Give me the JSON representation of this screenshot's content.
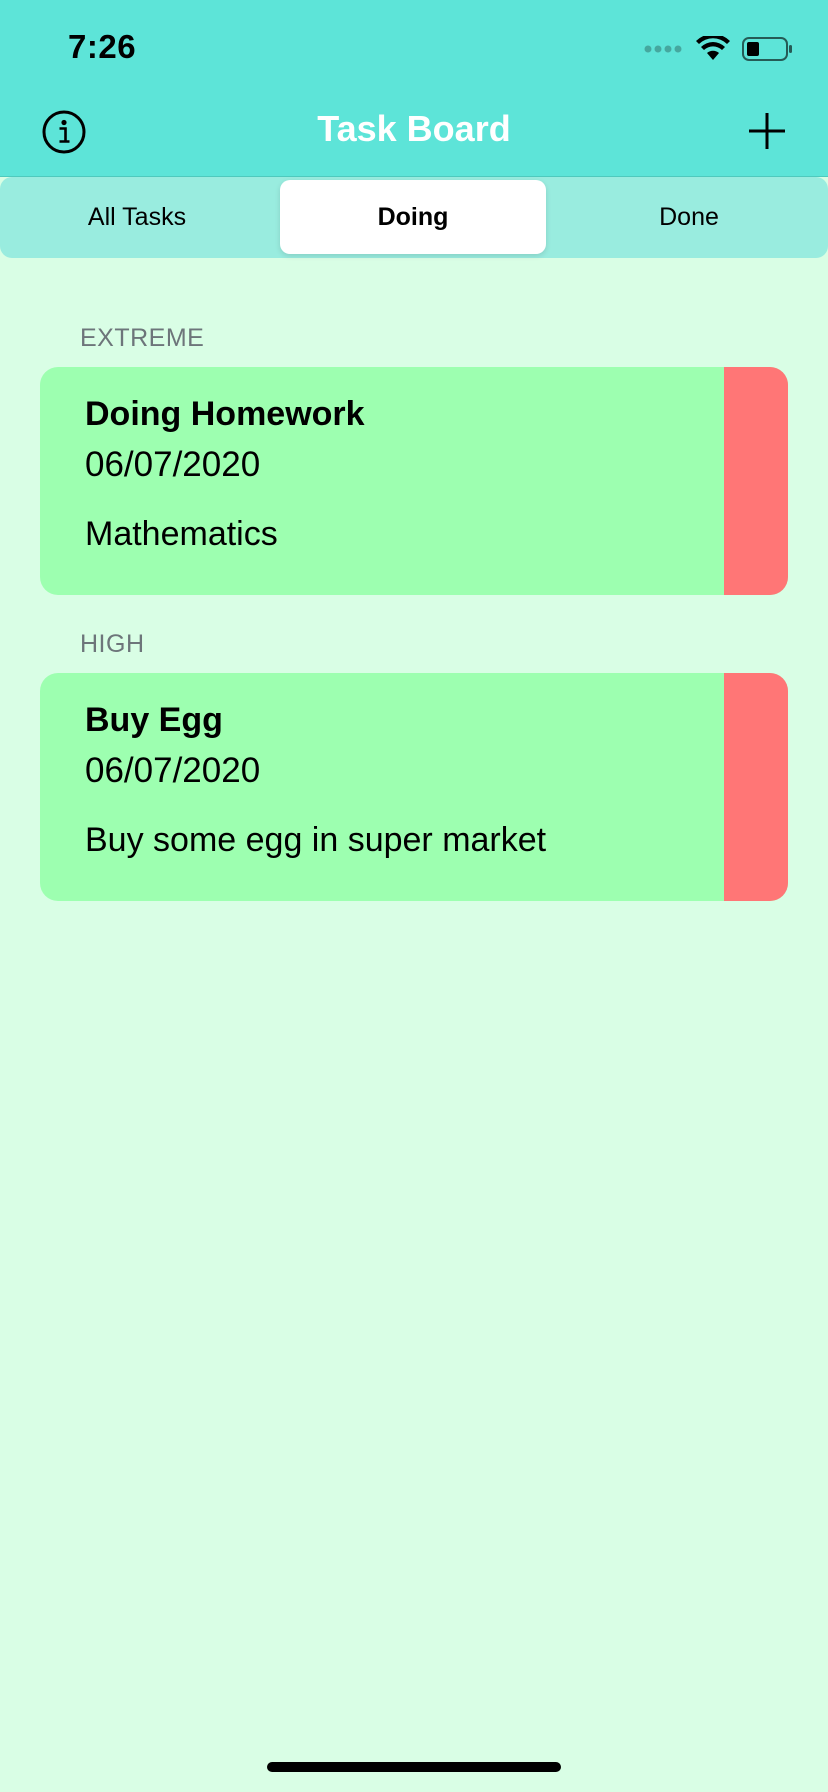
{
  "status_bar": {
    "time": "7:26",
    "signal_icon": "signal-dots-icon",
    "wifi_icon": "wifi-icon",
    "battery_icon": "battery-icon"
  },
  "nav": {
    "title": "Task Board",
    "info_icon": "info-circle-icon",
    "add_icon": "plus-icon"
  },
  "segments": [
    {
      "label": "All Tasks",
      "selected": false
    },
    {
      "label": "Doing",
      "selected": true
    },
    {
      "label": "Done",
      "selected": false
    }
  ],
  "sections": [
    {
      "label": "EXTREME",
      "task": {
        "title": "Doing Homework",
        "date": "06/07/2020",
        "description": "Mathematics"
      }
    },
    {
      "label": "HIGH",
      "task": {
        "title": "Buy Egg",
        "date": "06/07/2020",
        "description": "Buy some egg in super market"
      }
    }
  ],
  "colors": {
    "header": "#5de4d8",
    "background": "#d9fee5",
    "segment_bg": "#99ecdf",
    "card": "#9dffb0",
    "priority_stripe": "#ff7676"
  }
}
